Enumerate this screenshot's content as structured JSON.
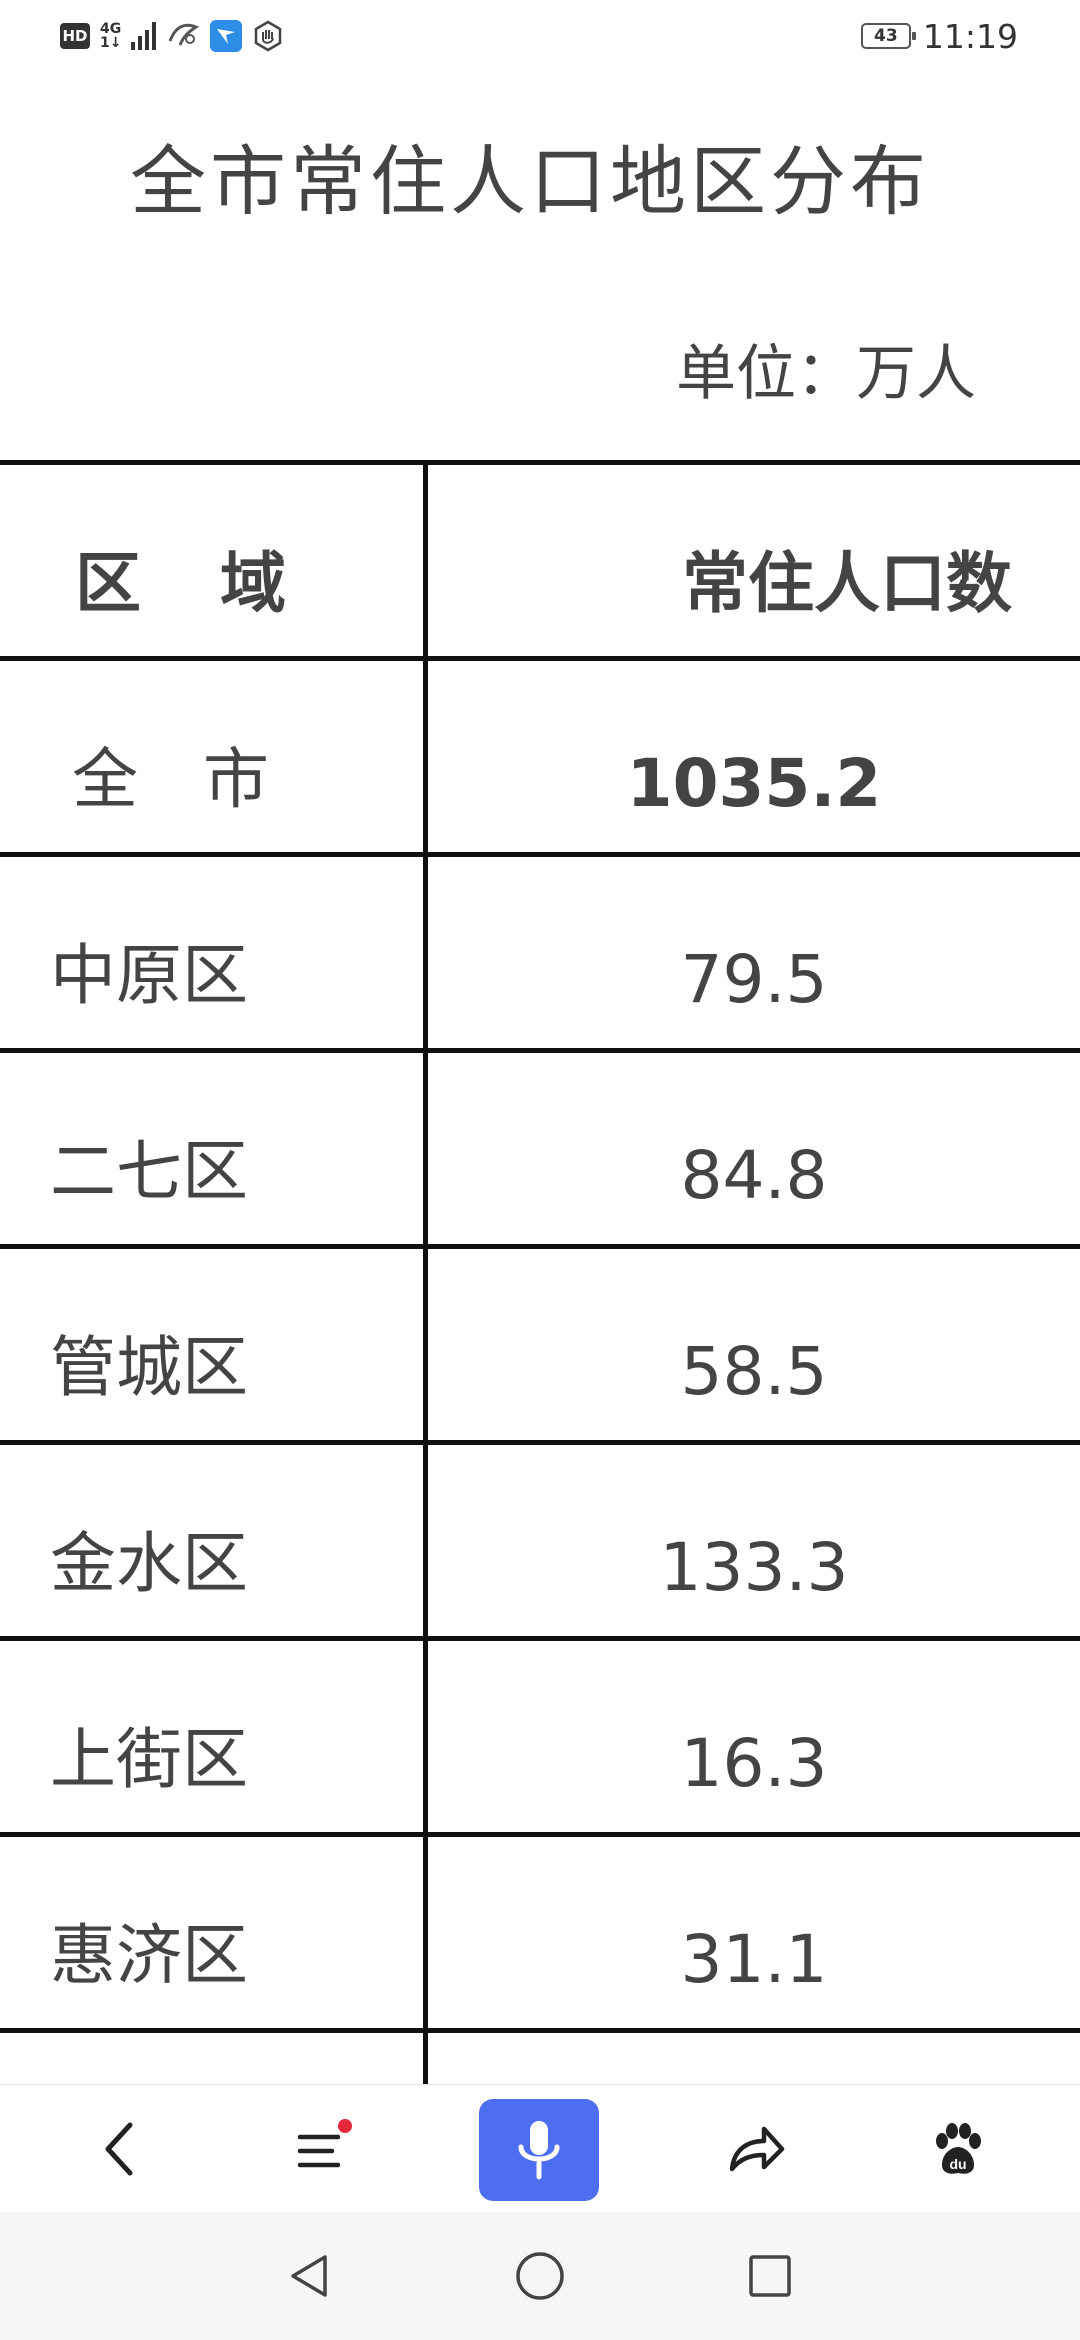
{
  "status_bar": {
    "hd": "HD",
    "network_top": "4G",
    "network_bottom": "1↓",
    "battery_level": "43",
    "time": "11:19"
  },
  "page": {
    "title": "全市常住人口地区分布",
    "unit": "单位：万人"
  },
  "table": {
    "headers": [
      "区 域",
      "常住人口数"
    ],
    "rows": [
      {
        "region": "全 市",
        "population": "1035.2"
      },
      {
        "region": "中原区",
        "population": "79.5"
      },
      {
        "region": "二七区",
        "population": "84.8"
      },
      {
        "region": "管城区",
        "population": "58.5"
      },
      {
        "region": "金水区",
        "population": "133.3"
      },
      {
        "region": "上街区",
        "population": "16.3"
      },
      {
        "region": "惠济区",
        "population": "31.1"
      },
      {
        "region": "",
        "population": ""
      }
    ]
  },
  "toolbar": {
    "icons": [
      "back-icon",
      "menu-icon",
      "microphone-icon",
      "share-icon",
      "baidu-paw-icon"
    ],
    "voice_color": "#4e6ef2",
    "notification_color": "#e5283c"
  },
  "navbar": {
    "icons": [
      "nav-back-icon",
      "nav-home-icon",
      "nav-recents-icon"
    ]
  }
}
